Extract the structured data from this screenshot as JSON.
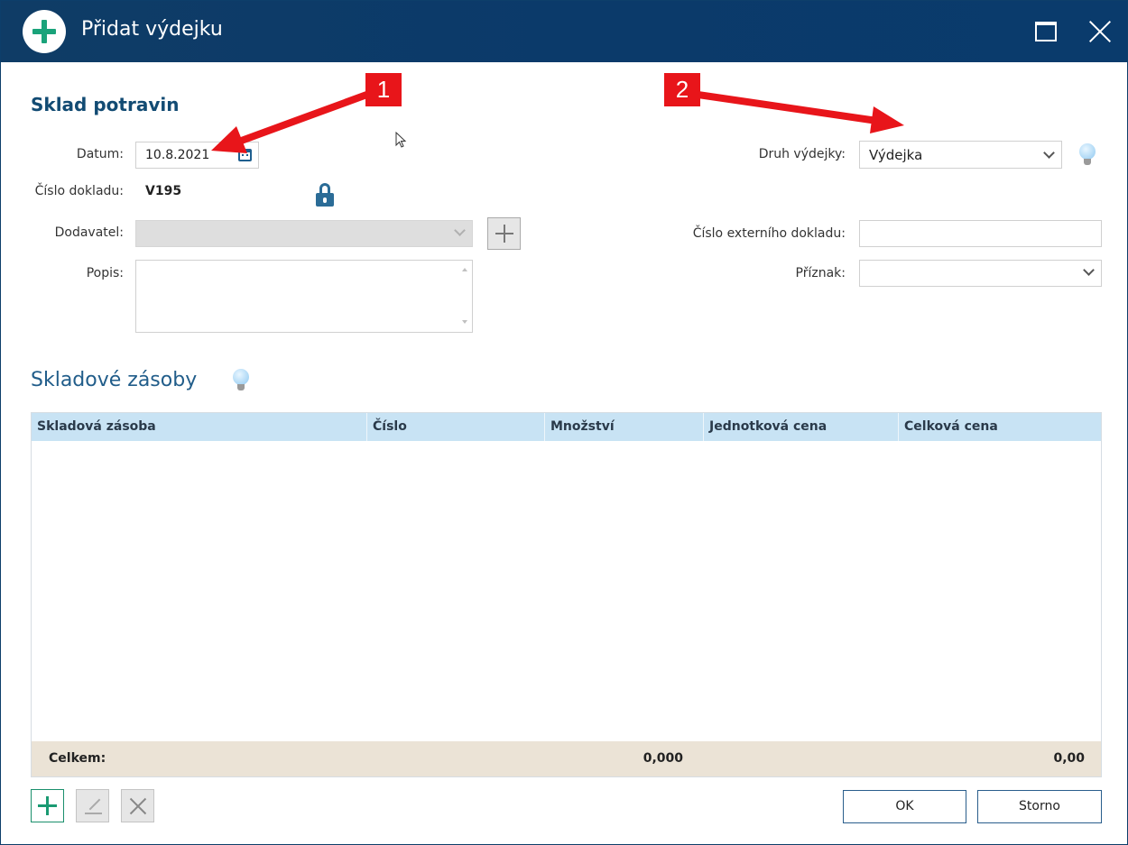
{
  "window": {
    "title": "Přidat výdejku"
  },
  "form": {
    "section_title": "Sklad potravin",
    "date_label": "Datum:",
    "date_value": "10.8.2021",
    "doc_number_label": "Číslo dokladu:",
    "doc_number_value": "V195",
    "supplier_label": "Dodavatel:",
    "supplier_value": "",
    "description_label": "Popis:",
    "description_value": "",
    "issue_type_label": "Druh výdejky:",
    "issue_type_value": "Výdejka",
    "external_doc_label": "Číslo externího dokladu:",
    "external_doc_value": "",
    "flag_label": "Příznak:",
    "flag_value": ""
  },
  "stock": {
    "title": "Skladové zásoby",
    "columns": [
      "Skladová zásoba",
      "Číslo",
      "Množství",
      "Jednotková cena",
      "Celková cena"
    ],
    "rows": [],
    "footer_label": "Celkem:",
    "total_quantity": "0,000",
    "total_price": "0,00"
  },
  "buttons": {
    "ok": "OK",
    "cancel": "Storno"
  },
  "annotations": {
    "marker_1": "1",
    "marker_2": "2",
    "color": "#e8151a"
  },
  "colors": {
    "titlebar": "#0b3a6a",
    "accent_green": "#1aa37a",
    "grid_header": "#c8e3f4",
    "grid_footer": "#ebe3d6"
  }
}
